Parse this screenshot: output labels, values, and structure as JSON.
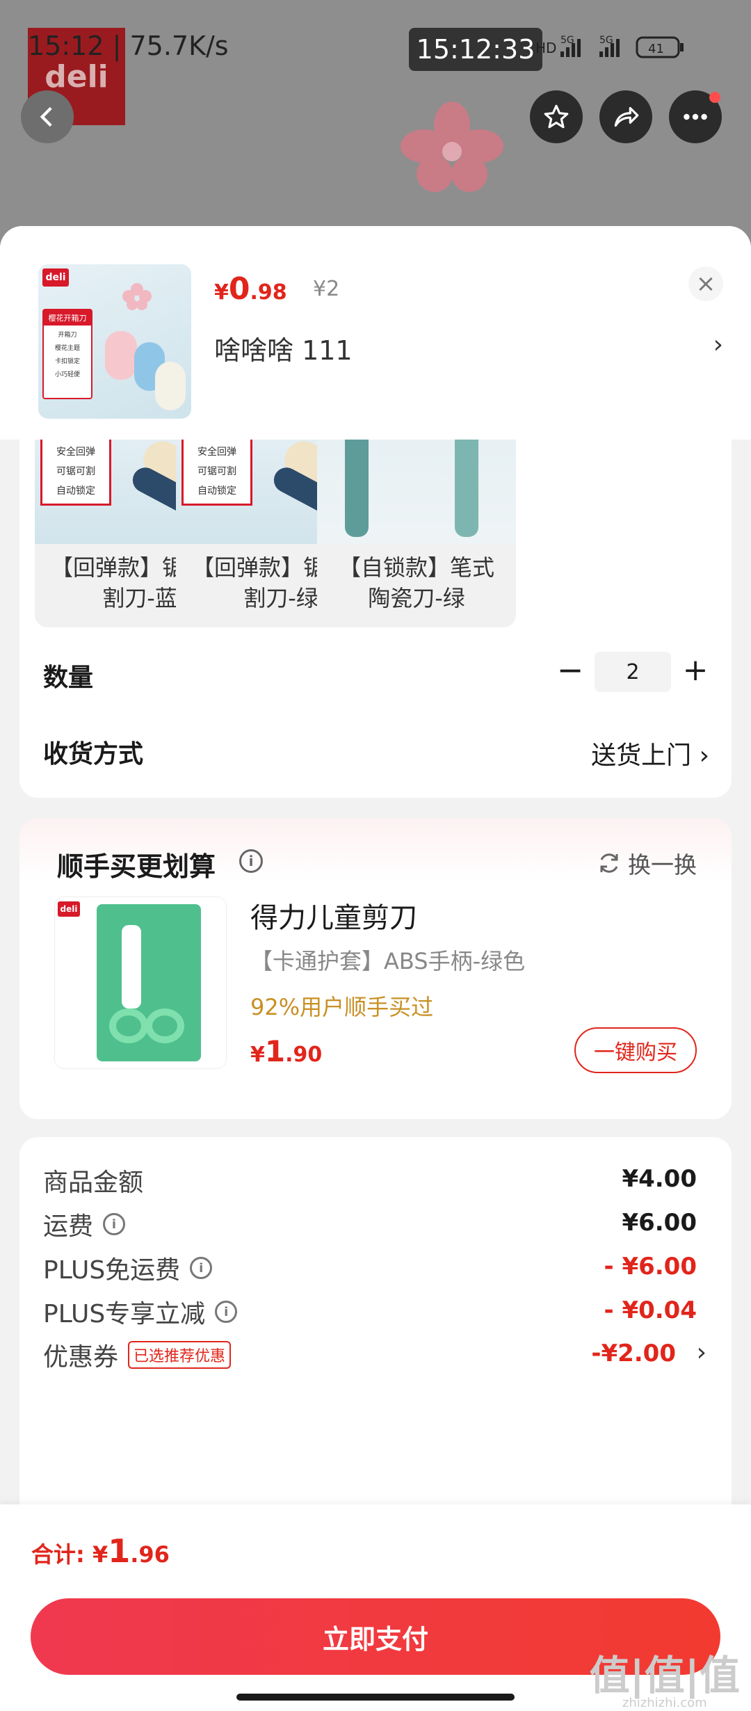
{
  "status_bar": {
    "left": "15:12 | 75.7K/s",
    "center_time": "15:12:33",
    "right_hd": "HD",
    "right_net1": "5G",
    "right_net2": "5G",
    "battery": "41"
  },
  "background": {
    "brand": "deli"
  },
  "product": {
    "thumb_brand": "deli",
    "thumb_title": "樱花开箱刀",
    "thumb_subtitle": "开箱刀",
    "thumb_lines": [
      "樱花主题",
      "卡扣锁定",
      "小巧轻便"
    ],
    "price_symbol": "¥",
    "price_int": "0",
    "price_dec": ".98",
    "price_old": "¥2",
    "selected_variant": "啥啥啥  111"
  },
  "options": [
    {
      "label": "【回弹款】锯齿切割刀-蓝",
      "thumb_lines": [
        "安全回弹",
        "可锯可割",
        "自动锁定"
      ]
    },
    {
      "label": "【回弹款】锯齿切割刀-绿",
      "thumb_lines": [
        "安全回弹",
        "可锯可割",
        "自动锁定"
      ]
    },
    {
      "label": "【自锁款】笔式陶瓷刀-绿"
    }
  ],
  "quantity": {
    "label": "数量",
    "minus": "−",
    "value": "2",
    "plus": "+"
  },
  "shipping": {
    "label": "收货方式",
    "value": "送货上门"
  },
  "addon": {
    "title": "顺手买更划算",
    "swap": "换一换",
    "brand": "deli",
    "name": "得力儿童剪刀",
    "spec": "【卡通护套】ABS手柄-绿色",
    "social": "92%用户顺手买过",
    "price_symbol": "¥",
    "price_int": "1",
    "price_dec": ".90",
    "buy": "一键购买"
  },
  "summary": [
    {
      "label": "商品金额",
      "value": "¥4.00",
      "red": false,
      "info": false
    },
    {
      "label": "运费",
      "value": "¥6.00",
      "red": false,
      "info": true
    },
    {
      "label": "PLUS免运费",
      "value": "- ¥6.00",
      "red": true,
      "info": true
    },
    {
      "label": "PLUS专享立减",
      "value": "- ¥0.04",
      "red": true,
      "info": true
    },
    {
      "label": "优惠券",
      "tag": "已选推荐优惠",
      "value": "-¥2.00",
      "red": true,
      "chevron": true
    }
  ],
  "bottom": {
    "total_label": "合计: ",
    "total_symbol": "¥",
    "total_int": "1",
    "total_dec": ".96",
    "pay": "立即支付"
  },
  "watermark": {
    "main": "值|值|值",
    "sub": "zhizhizhi.com"
  }
}
